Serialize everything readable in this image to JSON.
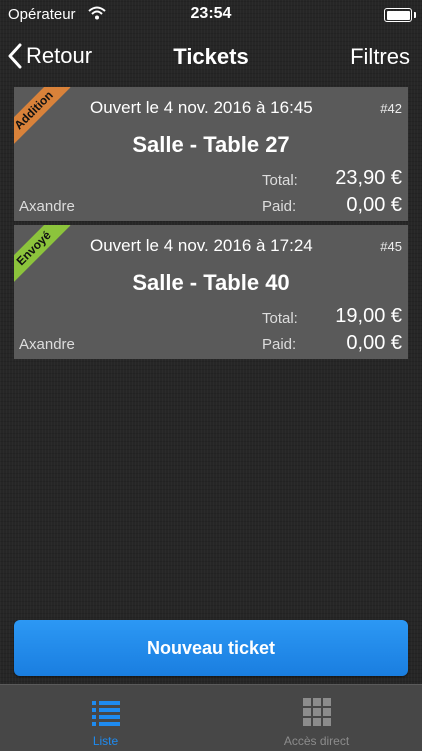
{
  "status_bar": {
    "carrier": "Opérateur",
    "time": "23:54"
  },
  "nav": {
    "back_label": "Retour",
    "title": "Tickets",
    "filter_label": "Filtres"
  },
  "tickets": [
    {
      "badge": "Addition",
      "badge_color": "#d9823a",
      "opened": "Ouvert le 4 nov. 2016 à 16:45",
      "number": "#42",
      "table": "Salle - Table 27",
      "total_label": "Total:",
      "total": "23,90 €",
      "author": "Axandre",
      "paid_label": "Paid:",
      "paid": "0,00 €"
    },
    {
      "badge": "Envoyé",
      "badge_color": "#8cc43c",
      "opened": "Ouvert le 4 nov. 2016 à 17:24",
      "number": "#45",
      "table": "Salle - Table 40",
      "total_label": "Total:",
      "total": "19,00 €",
      "author": "Axandre",
      "paid_label": "Paid:",
      "paid": "0,00 €"
    }
  ],
  "new_ticket_label": "Nouveau ticket",
  "tabs": [
    {
      "label": "Liste",
      "icon": "list-icon",
      "active": true,
      "color": "#1e8bf0"
    },
    {
      "label": "Accès direct",
      "icon": "grid-icon",
      "active": false,
      "color": "#8c8c8c"
    }
  ]
}
